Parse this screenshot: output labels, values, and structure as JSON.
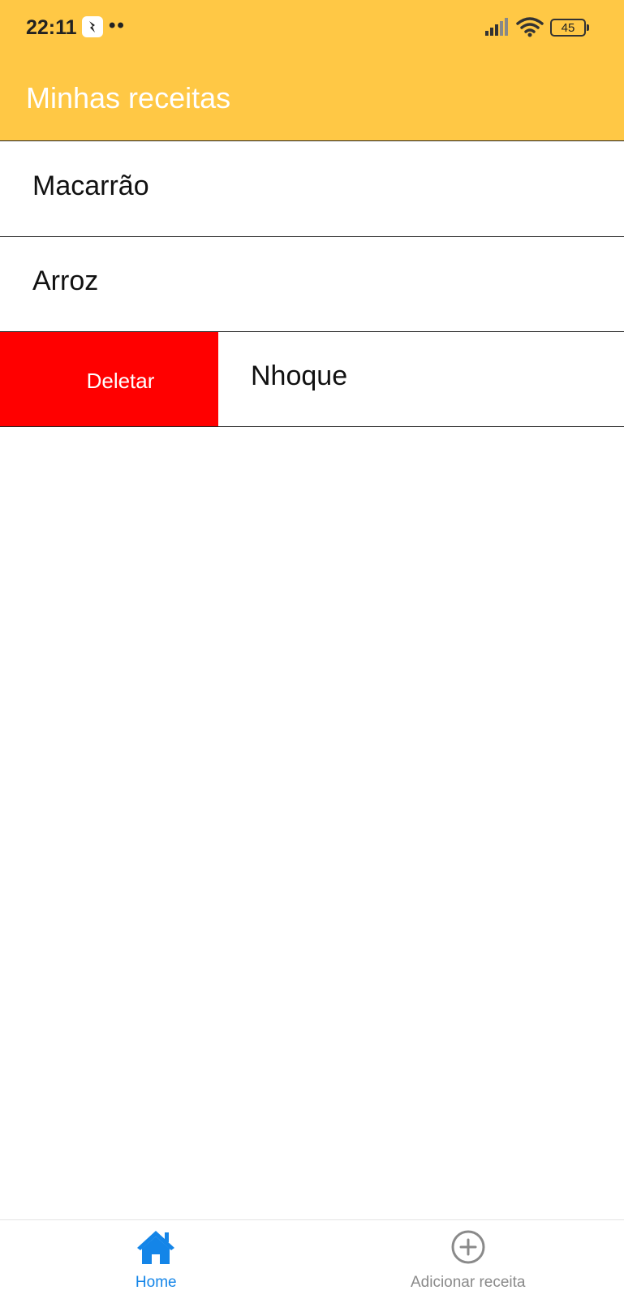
{
  "status_bar": {
    "time": "22:11",
    "dots": "••",
    "battery_level": "45"
  },
  "app_bar": {
    "title": "Minhas receitas",
    "background_color": "#FFC845"
  },
  "recipes": [
    {
      "name": "Macarrão"
    },
    {
      "name": "Arroz"
    },
    {
      "name": "Nhoque",
      "swiped": true,
      "action_label": "Deletar"
    }
  ],
  "delete_color": "#FF0000",
  "tab_bar": {
    "tabs": [
      {
        "label": "Home",
        "icon": "home-icon",
        "active": true
      },
      {
        "label": "Adicionar receita",
        "icon": "add-circle-icon",
        "active": false
      }
    ],
    "active_color": "#1485E8",
    "inactive_color": "#8a8a8a"
  }
}
